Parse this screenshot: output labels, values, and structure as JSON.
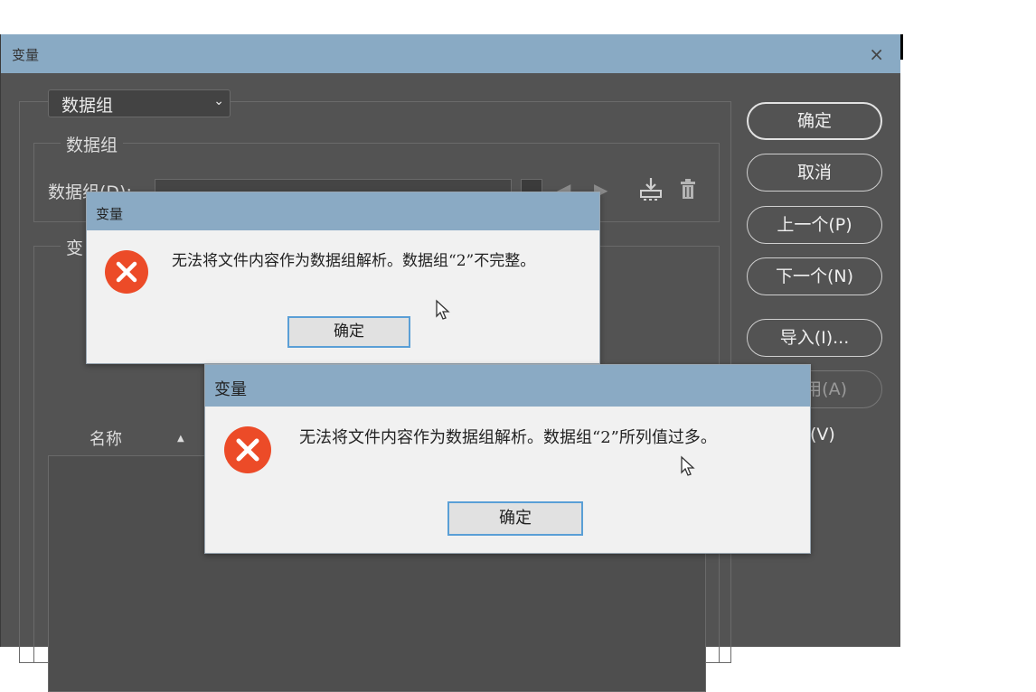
{
  "main_window": {
    "title": "变量",
    "close_glyph": "×",
    "dataset_select": {
      "value": "数据组",
      "arrow": "⌄"
    },
    "dataset_group_label": "数据组",
    "dataset_field_label": "数据组(D):",
    "variables_group_label": "变",
    "buttons": {
      "ok": "确定",
      "cancel": "取消",
      "prev": "上一个(P)",
      "next": "下一个(N)",
      "import": "导入(I)...",
      "apply": "用(A)",
      "preview": "(V)"
    },
    "list_header": {
      "name": "名称",
      "sort_glyph": "▲"
    },
    "icons": [
      "nav-left-icon",
      "nav-right-icon",
      "save-dataset-icon",
      "delete-dataset-icon"
    ]
  },
  "dialog_1": {
    "title": "变量",
    "message": "无法将文件内容作为数据组解析。数据组“2”不完整。",
    "ok_label": "确定",
    "icon": "error-icon"
  },
  "dialog_2": {
    "title": "变量",
    "message": "无法将文件内容作为数据组解析。数据组“2”所列值过多。",
    "ok_label": "确定",
    "icon": "error-icon"
  },
  "colors": {
    "title_bar": "#89aac4",
    "panel_bg": "#535353",
    "dialog_bg": "#f1f1f1",
    "error_red": "#ec4b28",
    "focus_blue": "#5a9fd6"
  }
}
